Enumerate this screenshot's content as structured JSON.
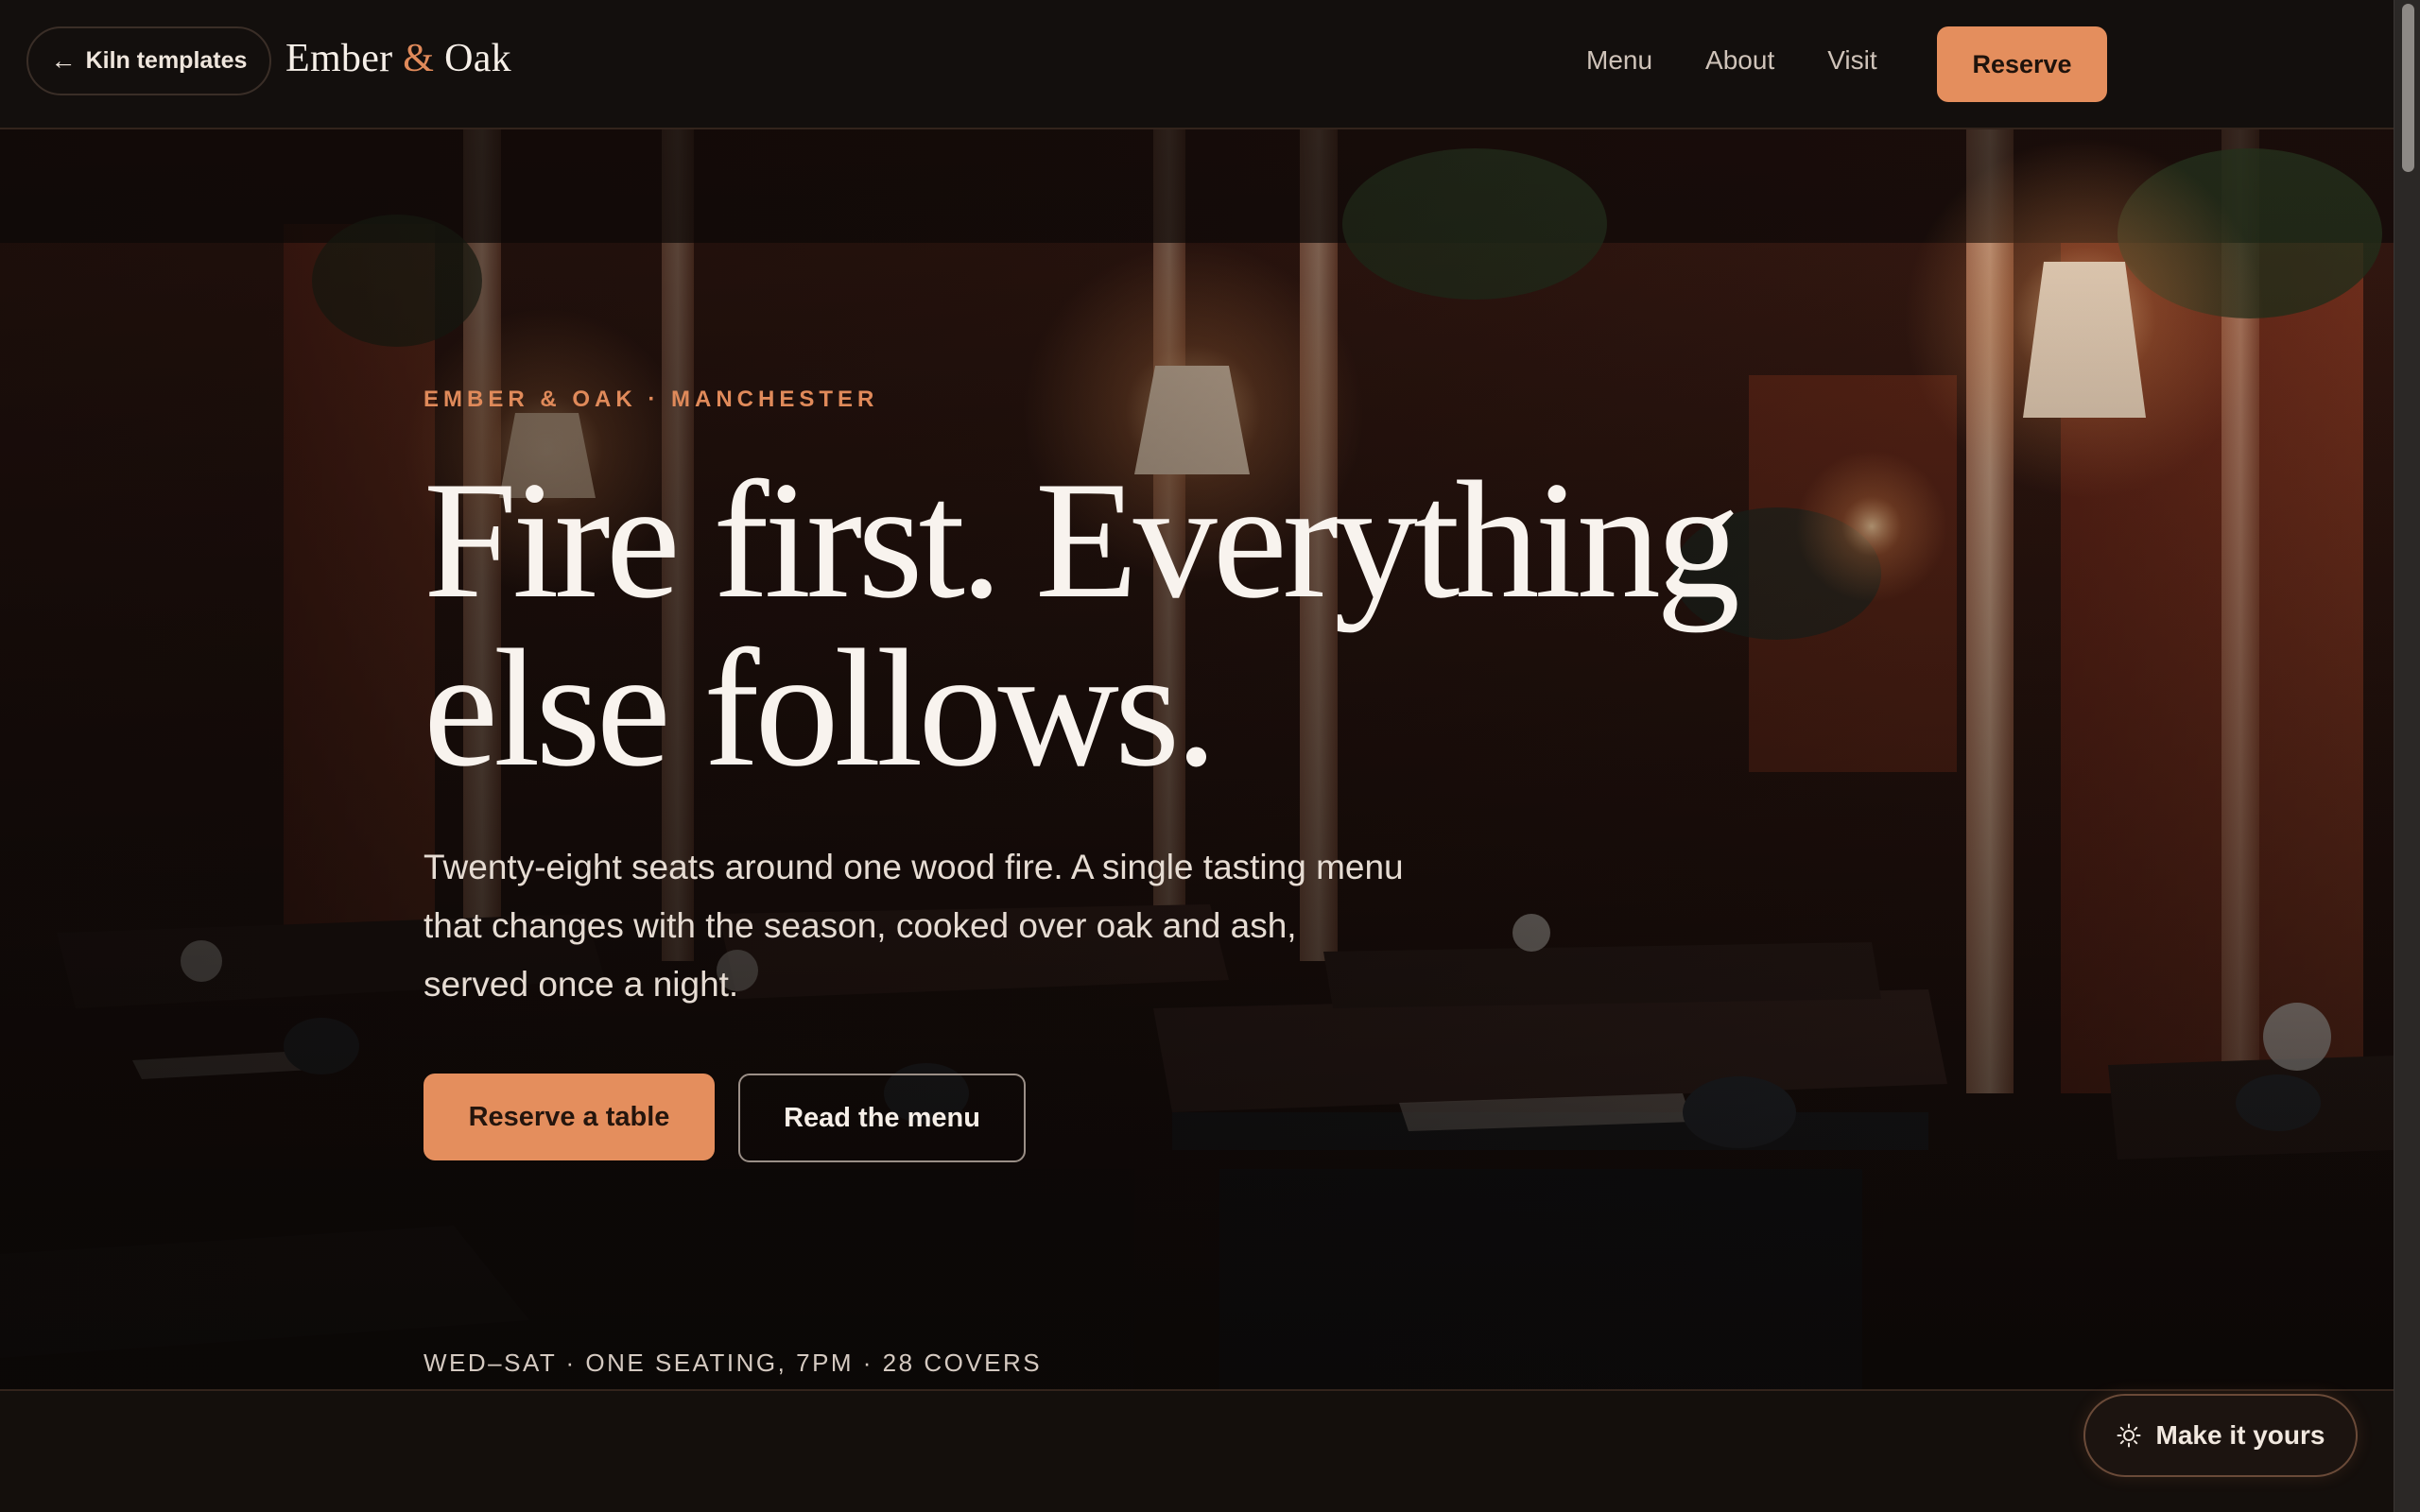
{
  "header": {
    "back_label": "Kiln templates",
    "brand": {
      "name_1": "Ember",
      "amp": "&",
      "name_2": "Oak"
    },
    "nav": [
      "Menu",
      "About",
      "Visit"
    ],
    "reserve_label": "Reserve"
  },
  "hero": {
    "eyebrow": "EMBER & OAK · MANCHESTER",
    "headline_line1": "Fire first. Everything",
    "headline_line2": "else follows.",
    "lede": "Twenty-eight seats around one wood fire. A single tasting menu that changes with the season, cooked over oak and ash, served once a night.",
    "primary_cta": "Reserve a table",
    "secondary_cta": "Read the menu",
    "meta": "WED–SAT · ONE SEATING, 7PM · 28 COVERS"
  },
  "floating": {
    "make_it_yours": "Make it yours"
  },
  "icons": {
    "back": "arrow-left-icon",
    "make_it_yours": "sun-icon"
  },
  "colors": {
    "accent": "#e48e5d",
    "background": "#130f0d",
    "text": "#f8f3ee"
  }
}
